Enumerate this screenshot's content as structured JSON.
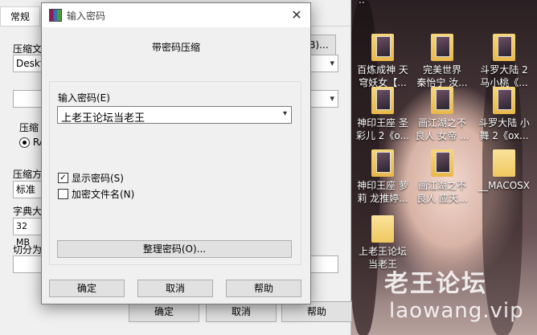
{
  "background_dialog": {
    "tab": "常规",
    "archive_name_label": "压缩文",
    "archive_name_value": "Deskto",
    "browse_button": "(B)...",
    "format_label": "压缩",
    "format_option": "RA",
    "method_label": "压缩方",
    "method_value": "标准",
    "dict_label": "字典大",
    "dict_value": "32 MB",
    "split_label": "切分为",
    "ok_button": "确定",
    "cancel_button": "取消",
    "help_button": "帮助"
  },
  "password_dialog": {
    "title": "输入密码",
    "close_symbol": "✕",
    "header": "带密码压缩",
    "password_label": "输入密码(E)",
    "password_value": "上老王论坛当老王",
    "show_password_label": "显示密码(S)",
    "show_password_checked": true,
    "encrypt_filenames_label": "加密文件名(N)",
    "encrypt_filenames_checked": false,
    "organize_button": "整理密码(O)...",
    "ok_button": "确定",
    "cancel_button": "取消",
    "help_button": "帮助"
  },
  "desktop": {
    "icons": [
      {
        "line1": "百炼成神  天",
        "line2": "穹妖女【..."
      },
      {
        "line1": "完美世界",
        "line2": "秦怡宁 汝..."
      },
      {
        "line1": "斗罗大陆 2",
        "line2": "马小桃《..."
      },
      {
        "line1": "神印王座  圣",
        "line2": "彩儿 2《o..."
      },
      {
        "line1": "画江湖之不",
        "line2": "良人 女帝 ..."
      },
      {
        "line1": "斗罗大陆 小",
        "line2": "舞 2《ox..."
      },
      {
        "line1": "神印王座  萝",
        "line2": "莉 龙推婷..."
      },
      {
        "line1": "画江湖之不",
        "line2": "良人 应天..."
      },
      {
        "line1": "__MACOSX",
        "line2": ""
      },
      {
        "line1": "上老王论坛",
        "line2": "当老王"
      }
    ],
    "watermark": "老王论坛",
    "watermark_url": "laowang.vip"
  }
}
